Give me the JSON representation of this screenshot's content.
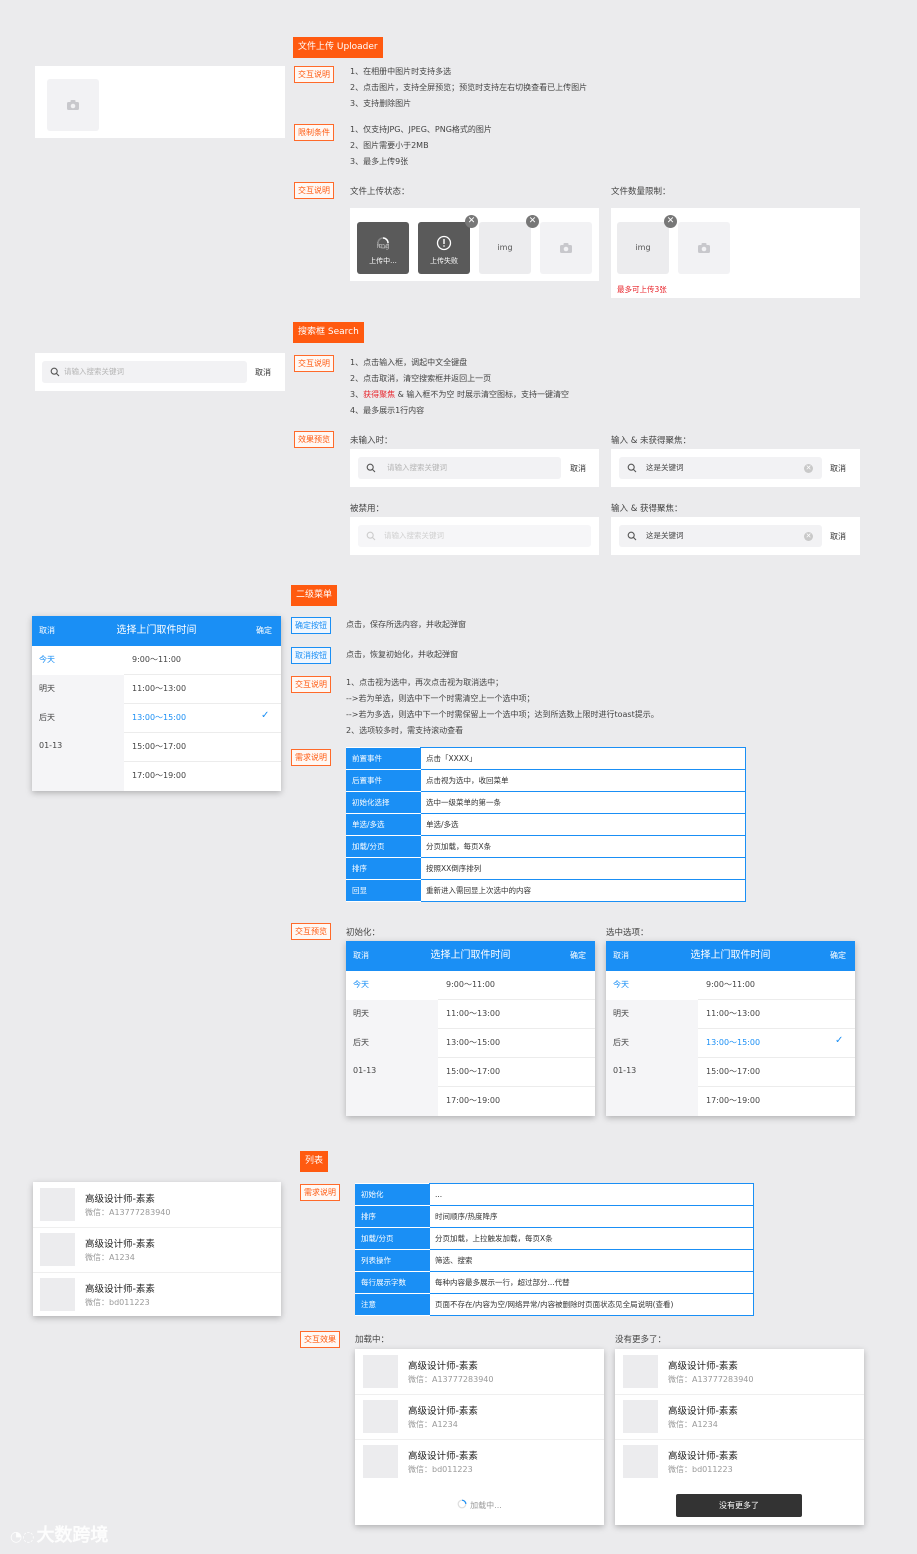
{
  "uploader": {
    "title": "文件上传 Uploader",
    "tag_interaction": "交互说明",
    "interaction_notes": [
      "1、在相册中图片时支持多选",
      "2、点击图片，支持全屏预览；预览时支持左右切换查看已上传图片",
      "3、支持删除图片"
    ],
    "tag_limits": "限制条件",
    "limit_notes": [
      "1、仅支持JPG、JPEG、PNG格式的图片",
      "2、图片需要小于2MB",
      "3、最多上传9张"
    ],
    "tag_interaction2": "交互说明",
    "status_label": "文件上传状态：",
    "count_label": "文件数量限制：",
    "uploading_text": "上传中...",
    "uploading_ghost": "img",
    "failed_text": "上传失败",
    "img_text": "img",
    "max_hint": "最多可上传3张"
  },
  "search": {
    "title": "搜索框 Search",
    "placeholder": "请输入搜索关键词",
    "cancel": "取消",
    "tag_interaction": "交互说明",
    "notes": [
      "1、点击输入框，调起中文全键盘",
      "2、点击取消，清空搜索框并返回上一页",
      "3、",
      "4、最多展示1行内容"
    ],
    "note3_highlight": "获得聚焦",
    "note3_rest": " & 输入框不为空 时展示清空图标，支持一键清空",
    "tag_preview": "效果预览",
    "label_empty": "未输入时：",
    "label_input_nofocus": "输入 & 未获得聚焦：",
    "label_disabled": "被禁用：",
    "label_input_focus": "输入 & 获得聚焦：",
    "keyword": "这是关键词"
  },
  "menu": {
    "title": "二级菜单",
    "picker_cancel": "取消",
    "picker_title": "选择上门取件时间",
    "picker_confirm": "确定",
    "days": [
      "今天",
      "明天",
      "后天",
      "01-13"
    ],
    "slots": [
      "9:00～11:00",
      "11:00～13:00",
      "13:00～15:00",
      "15:00～17:00",
      "17:00～19:00"
    ],
    "tag_confirm": "确定按钮",
    "confirm_note": "点击，保存所选内容，并收起弹窗",
    "tag_cancel": "取消按钮",
    "cancel_note": "点击，恢复初始化，并收起弹窗",
    "tag_interaction": "交互说明",
    "interaction_notes": [
      "1、点击视为选中，再次点击视为取消选中；",
      "-->若为单选，则选中下一个时需清空上一个选中项；",
      "-->若为多选，则选中下一个时需保留上一个选中项；达到所选数上限时进行toast提示。",
      "2、选项较多时，需支持滚动查看"
    ],
    "tag_requirement": "需求说明",
    "requirements": [
      {
        "k": "前置事件",
        "v": "点击「XXXX」"
      },
      {
        "k": "后置事件",
        "v": "点击视为选中，收回菜单"
      },
      {
        "k": "初始化选择",
        "v": "选中一级菜单的第一条"
      },
      {
        "k": "单选/多选",
        "v": "单选/多选"
      },
      {
        "k": "加载/分页",
        "v": "分页加载，每页X条"
      },
      {
        "k": "排序",
        "v": "按照XX倒序排列"
      },
      {
        "k": "回显",
        "v": "重新进入需回显上次选中的内容"
      }
    ],
    "tag_preview": "交互预览",
    "label_init": "初始化：",
    "label_selected": "选中选项："
  },
  "list": {
    "title": "列表",
    "items": [
      {
        "title": "高级设计师-素素",
        "sub": "微信：A13777283940"
      },
      {
        "title": "高级设计师-素素",
        "sub": "微信：A1234"
      },
      {
        "title": "高级设计师-素素",
        "sub": "微信：bd011223"
      }
    ],
    "tag_requirement": "需求说明",
    "requirements": [
      {
        "k": "初始化",
        "v": "..."
      },
      {
        "k": "排序",
        "v": "时间顺序/热度降序"
      },
      {
        "k": "加载/分页",
        "v": "分页加载，上拉触发加载，每页X条"
      },
      {
        "k": "列表操作",
        "v": "筛选、搜索"
      },
      {
        "k": "每行展示字数",
        "v": "每种内容最多展示一行，超过部分...代替"
      },
      {
        "k": "注意",
        "v": "页面不存在/内容为空/网络异常/内容被删除时页面状态见全局说明(查看)"
      }
    ],
    "tag_effect": "交互效果",
    "label_loading": "加载中：",
    "label_nomore": "没有更多了：",
    "loading_text": "加载中...",
    "nomore_text": "没有更多了"
  },
  "watermark": "大数跨境",
  "colors": {
    "accent": "#ff5a10",
    "blue": "#1a8ff5",
    "bg": "#ebebed"
  }
}
